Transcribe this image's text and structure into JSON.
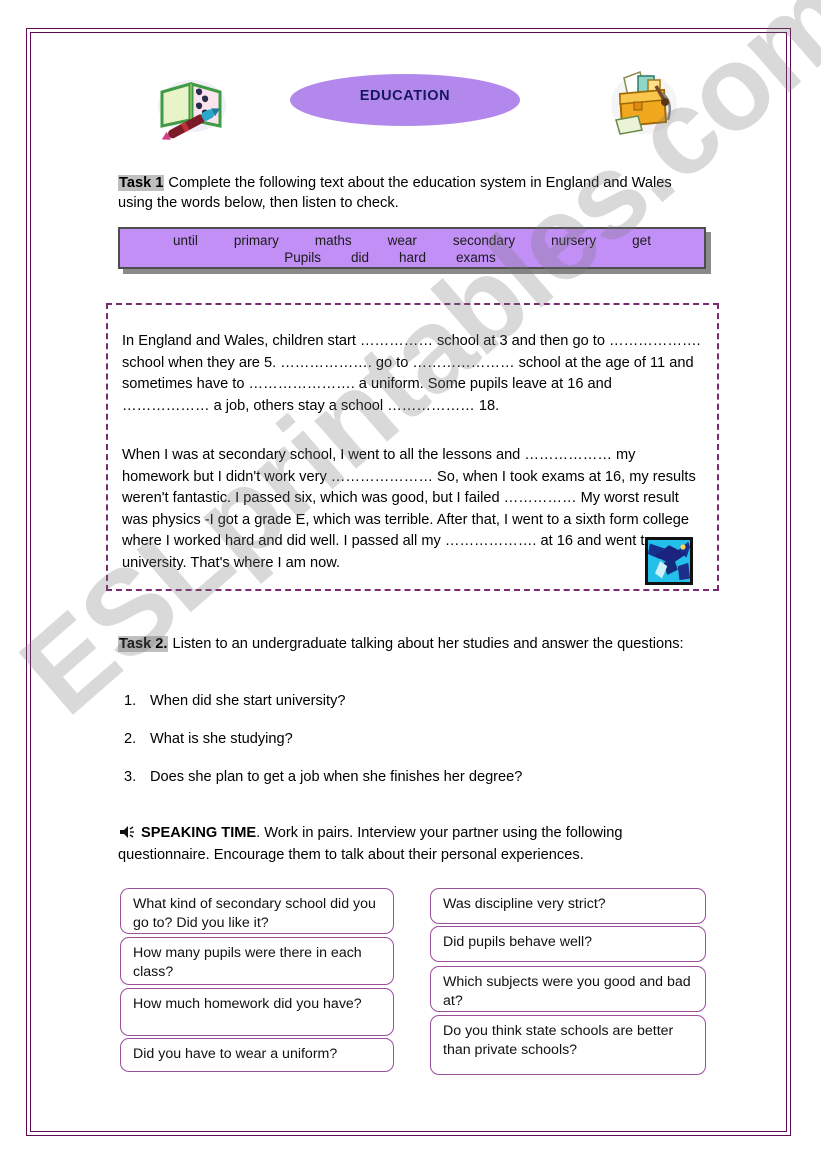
{
  "header": {
    "title": "EDUCATION",
    "left_clipart": "open-book-and-pen-clipart",
    "right_clipart": "school-bag-with-books-clipart"
  },
  "task1": {
    "tag": "Task 1",
    "instruction": " Complete the following text about the education system in England and Wales using the words below, then listen to check.",
    "wordbank_row1": [
      "until",
      "primary",
      "maths",
      "wear",
      "secondary",
      "nursery",
      "get"
    ],
    "wordbank_row2": [
      "Pupils",
      "did",
      "hard",
      "exams"
    ],
    "paragraph1": "In England and Wales, children start …………… school at 3 and then go to ………………. school when they are 5. ………………. go to ………………… school at the age of 11 and sometimes have to …………………. a uniform. Some pupils leave at 16 and ……………… a job, others stay a school ……………… 18.",
    "paragraph2": "When I was at secondary school, I went to all the lessons and ……………… my homework but I didn't work very ………………… So, when I took exams at 16, my results weren't fantastic. I passed six, which was good, but I failed …………… My worst result was physics -I got a grade E, which was terrible. After that, I went to a sixth form college where I worked hard and did well. I passed all my ………………. at 16 and went to university. That's where I am now.",
    "inline_image": "graduation-cap-clipart"
  },
  "task2": {
    "tag": "Task 2.",
    "instruction": " Listen to an undergraduate talking about her studies and answer the questions:",
    "questions": [
      {
        "num": "1.",
        "text": "When did she start university?"
      },
      {
        "num": "2.",
        "text": "What is she studying?"
      },
      {
        "num": "3.",
        "text": "Does she plan to get a job when she finishes her degree?"
      }
    ]
  },
  "speaking": {
    "icon": "speaker-icon",
    "heading": "SPEAKING TIME",
    "instruction": ". Work in pairs. Interview your partner using the following questionnaire. Encourage them to talk about their personal experiences.",
    "left_questions": [
      "What kind of secondary school did you go to? Did you like it?",
      "How many pupils were there in each class?",
      "How much homework did you have?",
      "Did you have to wear a uniform?"
    ],
    "right_questions": [
      "Was discipline very strict?",
      "Did pupils behave well?",
      "Which subjects were you good and bad at?",
      "Do you think state schools are better than private schools?"
    ]
  },
  "watermark": {
    "text": "ESLprintables.com"
  },
  "colors": {
    "page_border": "#5b0d52",
    "title_fill": "#b388ec",
    "title_text": "#16185e",
    "wordbank_fill": "#c18ff5",
    "wordbank_border": "#4d4d4d",
    "textbox_border": "#7a2a6e",
    "qbox_border": "#9b4f9b",
    "task_tag_bg": "#bfbfbf"
  }
}
